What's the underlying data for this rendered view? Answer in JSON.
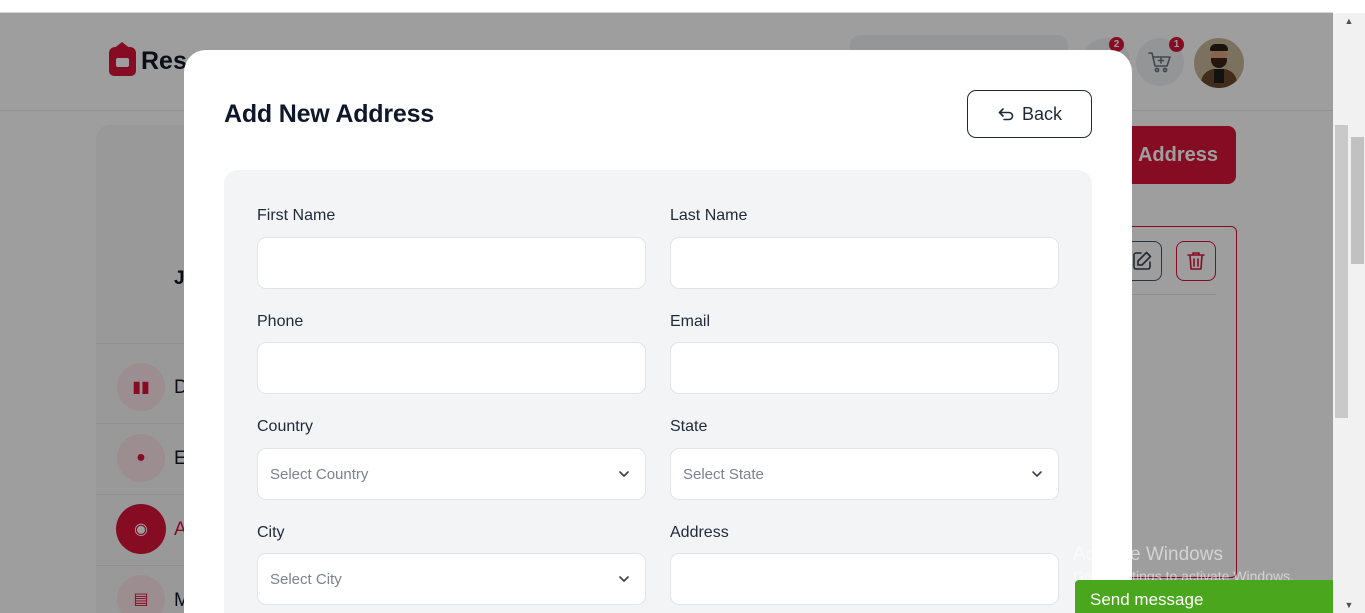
{
  "app": {
    "brand_partial": "Res"
  },
  "header": {
    "notifications_badge": "2",
    "cart_badge": "1"
  },
  "sidebar": {
    "items": [
      {
        "letter": "D",
        "icon": "dashboard-icon"
      },
      {
        "letter": "E",
        "icon": "user-icon"
      },
      {
        "letter": "A",
        "icon": "location-icon",
        "active": true
      },
      {
        "letter": "M",
        "icon": "list-icon"
      }
    ],
    "name_initial": "J"
  },
  "background": {
    "add_address_label": "Address"
  },
  "modal": {
    "title": "Add New Address",
    "back_label": "Back",
    "fields": {
      "first_name": {
        "label": "First Name",
        "value": ""
      },
      "last_name": {
        "label": "Last Name",
        "value": ""
      },
      "phone": {
        "label": "Phone",
        "value": ""
      },
      "email": {
        "label": "Email",
        "value": ""
      },
      "country": {
        "label": "Country",
        "placeholder": "Select Country"
      },
      "state": {
        "label": "State",
        "placeholder": "Select State"
      },
      "city": {
        "label": "City",
        "placeholder": "Select City"
      },
      "address": {
        "label": "Address",
        "value": ""
      }
    }
  },
  "watermark": {
    "title": "Activate Windows",
    "subtitle": "Go to Settings to activate Windows."
  },
  "chat": {
    "send_message_label": "Send message"
  },
  "colors": {
    "accent": "#d8143a",
    "panel": "#f3f4f6",
    "chat": "#4aa61c"
  }
}
